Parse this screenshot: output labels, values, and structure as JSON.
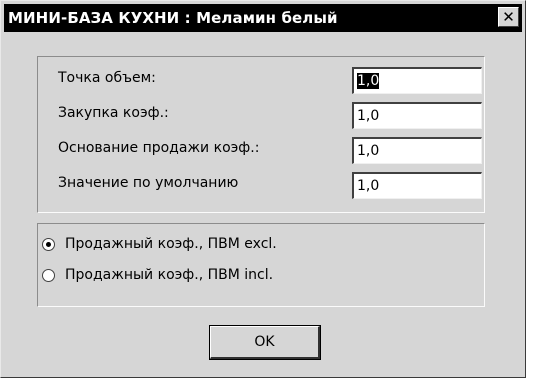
{
  "window": {
    "title": "МИНИ-БАЗА КУХНИ : Меламин белый",
    "close_label": "✕"
  },
  "fields": [
    {
      "label": "Точка объем:",
      "value": "1,0"
    },
    {
      "label": "Закупка коэф.:",
      "value": "1,0"
    },
    {
      "label": "Основание продажи коэф.:",
      "value": "1,0"
    },
    {
      "label": "Значение по умолчанию",
      "value": "1,0"
    }
  ],
  "options": [
    {
      "label": "Продажный коэф., ПВМ excl.",
      "selected": true
    },
    {
      "label": "Продажный коэф., ПВМ incl.",
      "selected": false
    }
  ],
  "buttons": {
    "ok_label": "OK"
  }
}
